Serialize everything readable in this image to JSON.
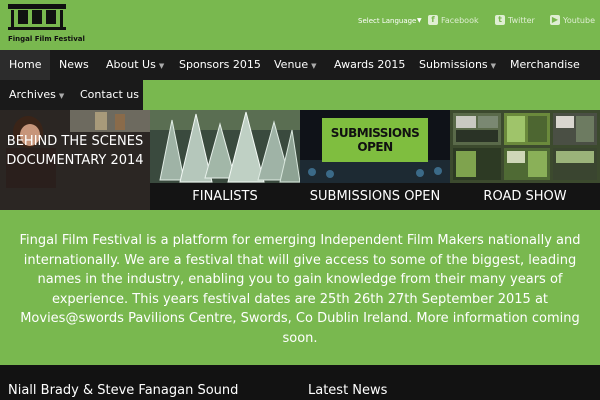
{
  "logo": {
    "text": "Fingal Film Festival"
  },
  "header": {
    "language_label": "Select Language",
    "language_caret": "▼",
    "social": [
      {
        "icon": "facebook-icon",
        "glyph": "f",
        "label": "Facebook"
      },
      {
        "icon": "twitter-icon",
        "glyph": "t",
        "label": "Twitter"
      },
      {
        "icon": "youtube-icon",
        "glyph": "▶",
        "label": "Youtube"
      }
    ]
  },
  "nav": {
    "items": [
      {
        "label": "Home",
        "dropdown": false,
        "active": true
      },
      {
        "label": "News",
        "dropdown": false
      },
      {
        "label": "About Us",
        "dropdown": true
      },
      {
        "label": "Sponsors 2015",
        "dropdown": false
      },
      {
        "label": "Venue",
        "dropdown": true
      },
      {
        "label": "Awards 2015",
        "dropdown": false
      },
      {
        "label": "Submissions",
        "dropdown": true
      },
      {
        "label": "Merchandise",
        "dropdown": false
      },
      {
        "label": "Archives",
        "dropdown": true
      },
      {
        "label": "Contact us",
        "dropdown": false
      }
    ],
    "caret": "▼"
  },
  "banners": [
    {
      "label": "",
      "overlay_text": "BEHIND THE SCENES DOCUMENTARY 2014"
    },
    {
      "label": "FINALISTS"
    },
    {
      "label": "SUBMISSIONS OPEN",
      "sign_text": "SUBMISSIONS OPEN"
    },
    {
      "label": "ROAD SHOW"
    }
  ],
  "description": "Fingal Film Festival is a platform for emerging Independent Film Makers nationally and internationally. We are a festival that will give access to some of the biggest, leading names in the industry, enabling you to gain knowledge from their many years of experience. This years festival dates are 25th 26th 27th September 2015 at Movies@swords Pavilions Centre, Swords, Co Dublin Ireland. More information coming soon.",
  "footer": {
    "left_heading": "Niall Brady & Steve Fanagan Sound",
    "right_heading": "Latest News"
  },
  "colors": {
    "brand_green": "#79b84f",
    "nav_dark": "#1a1a1a"
  }
}
